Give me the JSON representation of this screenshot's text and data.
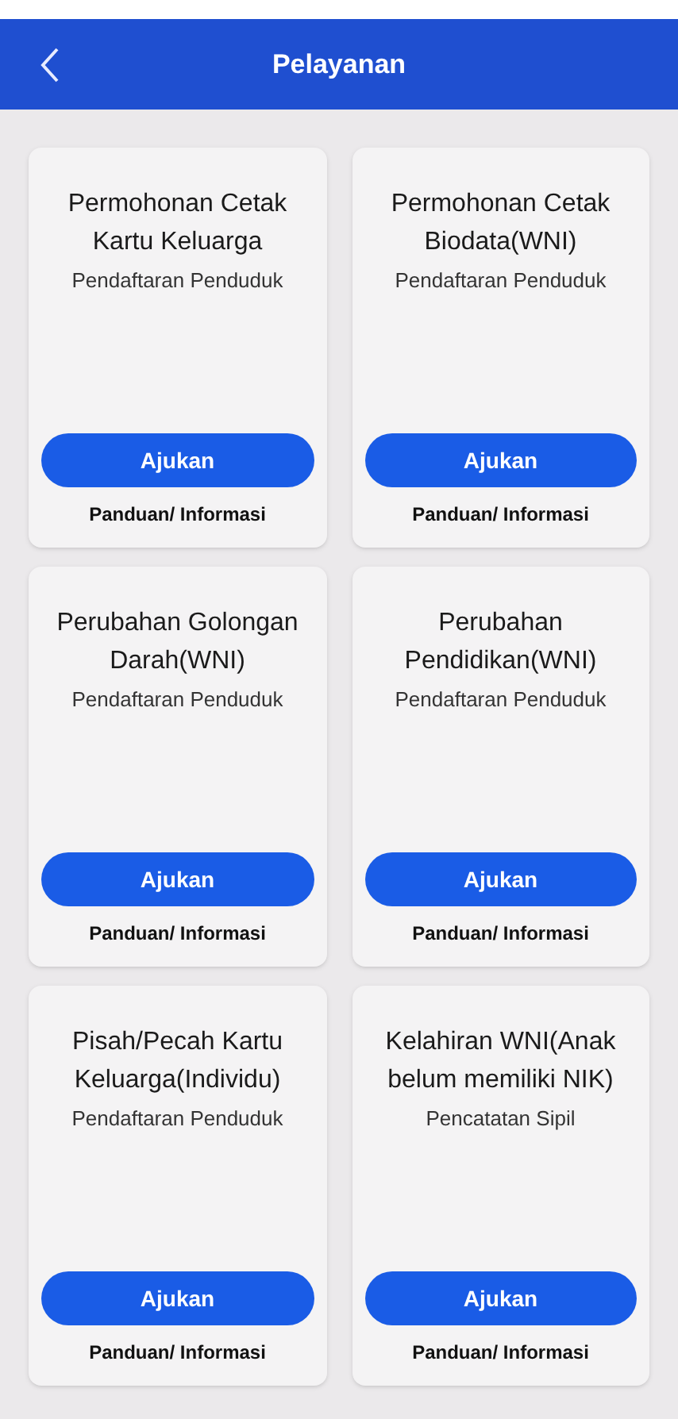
{
  "header": {
    "title": "Pelayanan"
  },
  "services": [
    {
      "title": "Permohonan Cetak Kartu Keluarga",
      "category": "Pendaftaran Penduduk",
      "action": "Ajukan",
      "link": "Panduan/ Informasi"
    },
    {
      "title": "Permohonan Cetak Biodata(WNI)",
      "category": "Pendaftaran Penduduk",
      "action": "Ajukan",
      "link": "Panduan/ Informasi"
    },
    {
      "title": "Perubahan Golongan Darah(WNI)",
      "category": "Pendaftaran Penduduk",
      "action": "Ajukan",
      "link": "Panduan/ Informasi"
    },
    {
      "title": "Perubahan Pendidikan(WNI)",
      "category": "Pendaftaran Penduduk",
      "action": "Ajukan",
      "link": "Panduan/ Informasi"
    },
    {
      "title": "Pisah/Pecah Kartu Keluarga(Individu)",
      "category": "Pendaftaran Penduduk",
      "action": "Ajukan",
      "link": "Panduan/ Informasi"
    },
    {
      "title": "Kelahiran WNI(Anak belum memiliki NIK)",
      "category": "Pencatatan Sipil",
      "action": "Ajukan",
      "link": "Panduan/ Informasi"
    }
  ]
}
